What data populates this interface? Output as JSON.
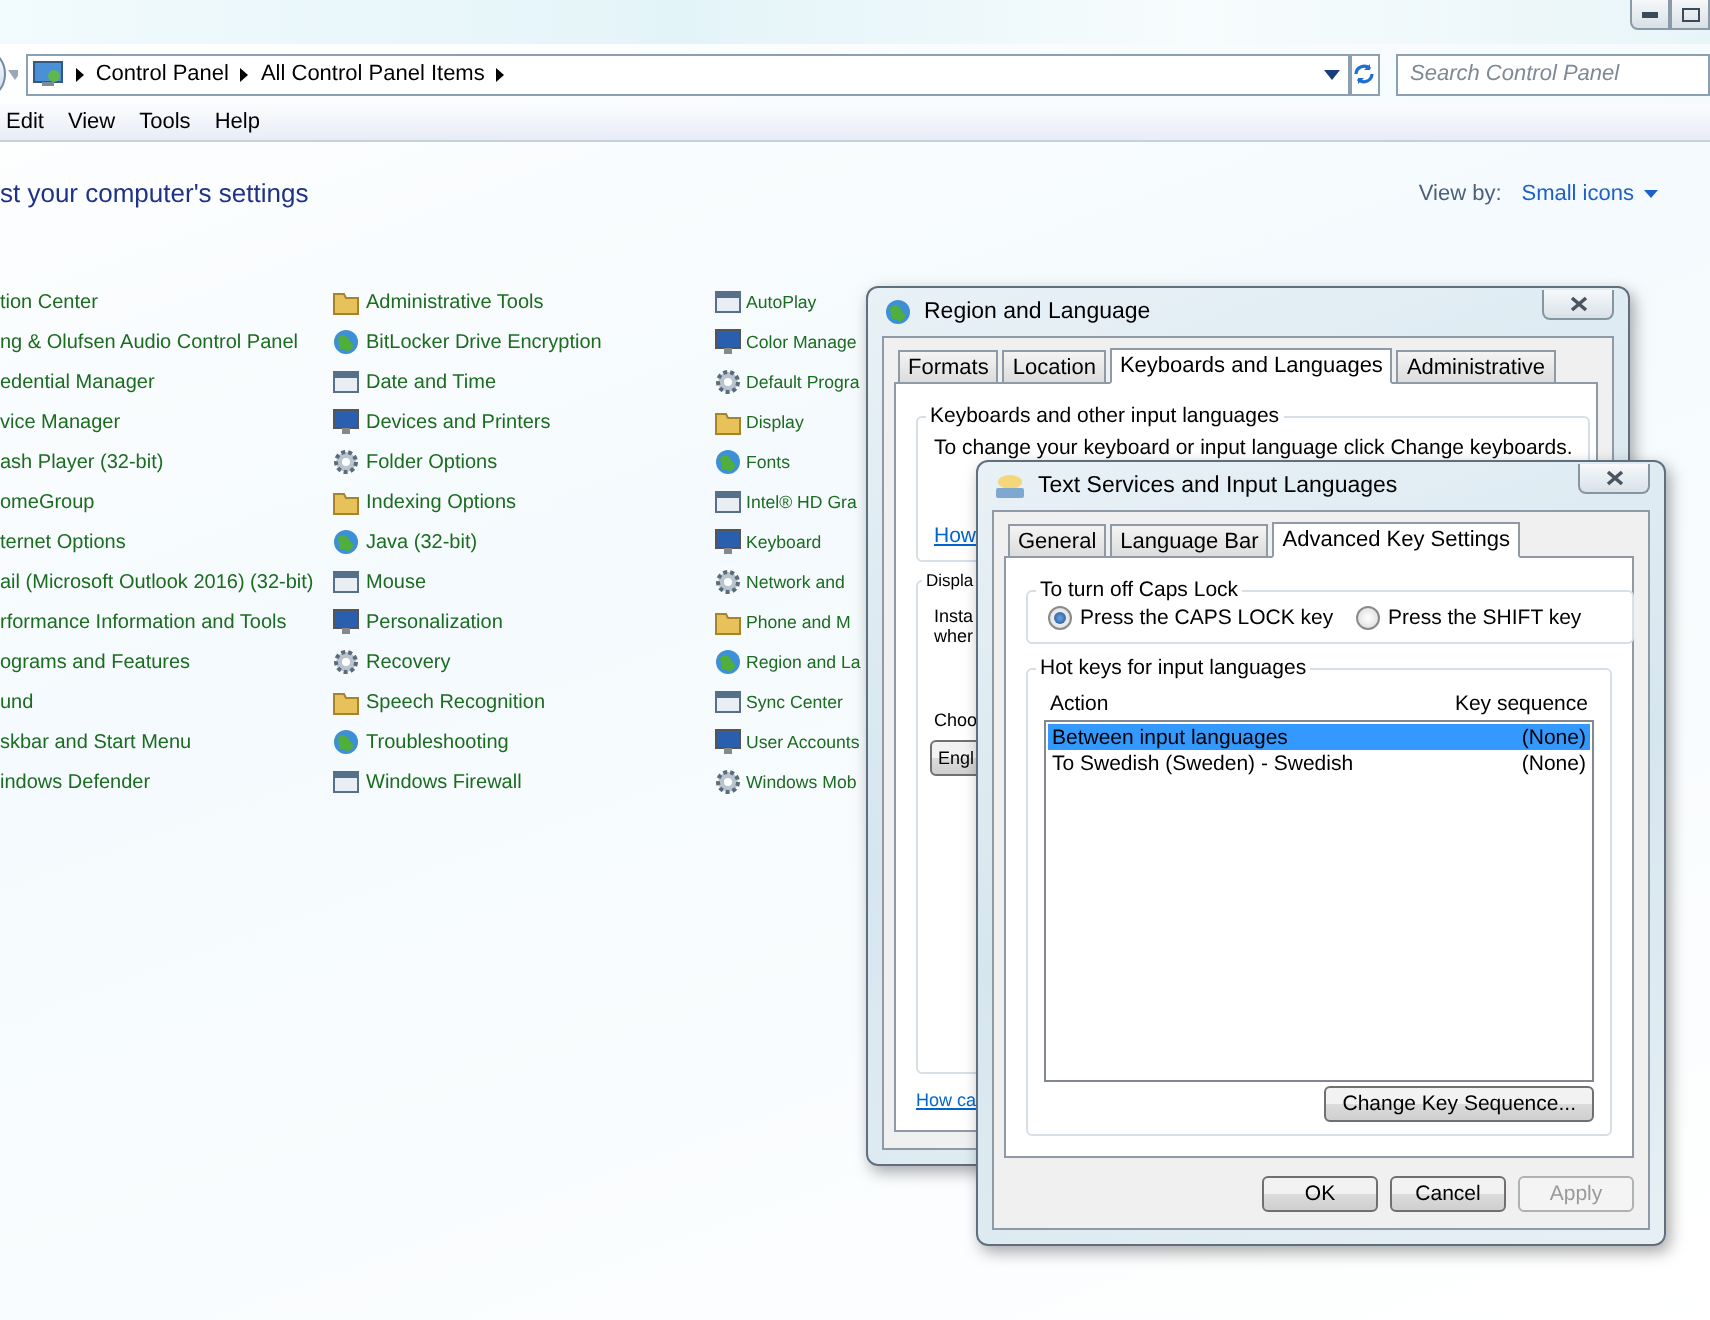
{
  "address_bar": {
    "breadcrumbs": [
      "Control Panel",
      "All Control Panel Items"
    ]
  },
  "search": {
    "placeholder": "Search Control Panel"
  },
  "menu": [
    "Edit",
    "View",
    "Tools",
    "Help"
  ],
  "heading": "st your computer's settings",
  "view_by": {
    "label": "View by:",
    "value": "Small icons"
  },
  "columns": [
    {
      "items": [
        "tion Center",
        "ng & Olufsen Audio Control Panel",
        "edential Manager",
        "vice Manager",
        "ash Player (32-bit)",
        "omeGroup",
        "ternet Options",
        "ail (Microsoft Outlook 2016) (32-bit)",
        "rformance Information and Tools",
        "ograms and Features",
        "und",
        "skbar and Start Menu",
        "indows Defender"
      ]
    },
    {
      "items": [
        "Administrative Tools",
        "BitLocker Drive Encryption",
        "Date and Time",
        "Devices and Printers",
        "Folder Options",
        "Indexing Options",
        "Java (32-bit)",
        "Mouse",
        "Personalization",
        "Recovery",
        "Speech Recognition",
        "Troubleshooting",
        "Windows Firewall"
      ]
    },
    {
      "items": [
        "AutoPlay",
        "Color Manage",
        "Default Progra",
        "Display",
        "Fonts",
        "Intel® HD Gra",
        "Keyboard",
        "Network and",
        "Phone and M",
        "Region and La",
        "Sync Center",
        "User Accounts",
        "Windows Mob"
      ]
    }
  ],
  "region_dialog": {
    "title": "Region and Language",
    "tabs": [
      {
        "label": "Formats",
        "selected": false
      },
      {
        "label": "Location",
        "selected": false
      },
      {
        "label": "Keyboards and Languages",
        "selected": true
      },
      {
        "label": "Administrative",
        "selected": false
      }
    ],
    "keyboards_group": {
      "title": "Keyboards and other input languages",
      "text": "To change your keyboard or input language click Change keyboards.",
      "link": "How"
    },
    "display_group": {
      "title": "Displa",
      "lines": [
        "Insta",
        "wher"
      ],
      "label": "Choo",
      "button": "Engl"
    },
    "footer_link": "How ca"
  },
  "text_services_dialog": {
    "title": "Text Services and Input Languages",
    "tabs": [
      {
        "label": "General",
        "selected": false
      },
      {
        "label": "Language Bar",
        "selected": false
      },
      {
        "label": "Advanced Key Settings",
        "selected": true
      }
    ],
    "caps_lock": {
      "title": "To turn off Caps Lock",
      "options": [
        {
          "label": "Press the CAPS LOCK key",
          "selected": true
        },
        {
          "label": "Press the SHIFT key",
          "selected": false
        }
      ]
    },
    "hotkeys": {
      "title": "Hot keys for input languages",
      "columns": [
        "Action",
        "Key sequence"
      ],
      "rows": [
        {
          "action": "Between input languages",
          "key": "(None)",
          "selected": true
        },
        {
          "action": "To Swedish (Sweden) - Swedish",
          "key": "(None)",
          "selected": false
        }
      ],
      "button": "Change Key Sequence..."
    },
    "buttons": [
      {
        "label": "OK",
        "disabled": false
      },
      {
        "label": "Cancel",
        "disabled": false
      },
      {
        "label": "Apply",
        "disabled": true
      }
    ]
  }
}
